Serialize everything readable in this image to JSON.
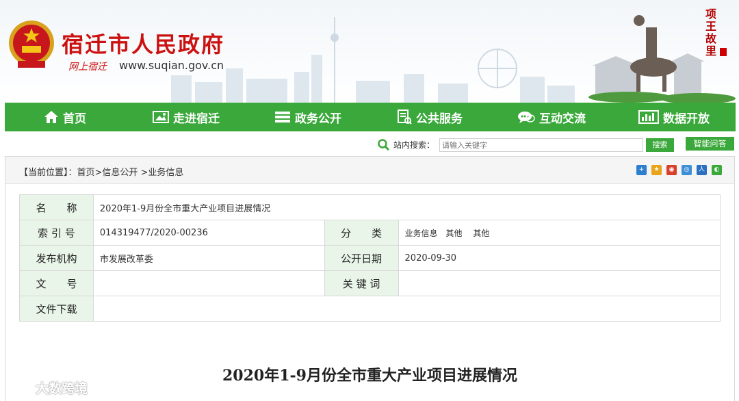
{
  "header": {
    "site_title": "宿迁市人民政府",
    "site_sub": "网上宿迁",
    "site_url": "www.suqian.gov.cn",
    "seal_text": "项王故里"
  },
  "nav": {
    "items": [
      {
        "label": "首页",
        "icon": "home-icon"
      },
      {
        "label": "走进宿迁",
        "icon": "picture-icon"
      },
      {
        "label": "政务公开",
        "icon": "stack-icon"
      },
      {
        "label": "公共服务",
        "icon": "document-icon"
      },
      {
        "label": "互动交流",
        "icon": "chat-icon"
      },
      {
        "label": "数据开放",
        "icon": "data-icon"
      }
    ],
    "color": "#3aa83a"
  },
  "search": {
    "label": "站内搜索：",
    "placeholder": "请输入关键字",
    "button": "搜索",
    "qa_button": "智能问答"
  },
  "breadcrumb": {
    "text": "【当前位置】：首页>信息公开 >业务信息"
  },
  "share_icons": [
    "plus-share-icon",
    "qzone-icon",
    "weibo-icon",
    "qq-icon",
    "renren-icon",
    "wechat-icon"
  ],
  "info": {
    "name_label": "名　　称",
    "name_value": "2020年1-9月份全市重大产业项目进展情况",
    "index_label": "索 引 号",
    "index_value": "014319477/2020-00236",
    "category_label": "分　　类",
    "category_value": "业务信息　其他　 其他",
    "publisher_label": "发布机构",
    "publisher_value": "市发展改革委",
    "date_label": "公开日期",
    "date_value": "2020-09-30",
    "docno_label": "文　　号",
    "docno_value": "",
    "keywords_label": "关 键 词",
    "keywords_value": "",
    "download_label": "文件下载",
    "download_value": ""
  },
  "document": {
    "title": "2020年1-9月份全市重大产业项目进展情况"
  },
  "watermark": {
    "text": "大数跨境"
  }
}
